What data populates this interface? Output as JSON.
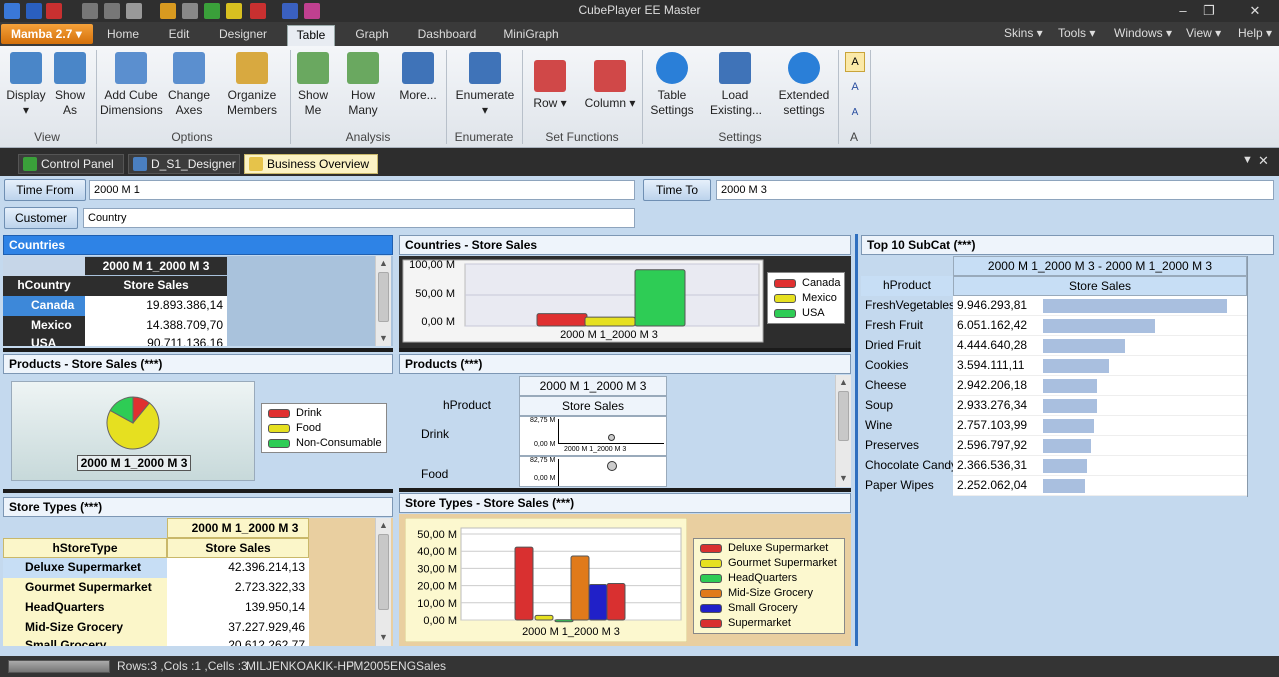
{
  "window": {
    "title": "CubePlayer EE Master"
  },
  "menu": {
    "app_button": "Mamba 2.7",
    "tabs": [
      {
        "label": "Home"
      },
      {
        "label": "Edit"
      },
      {
        "label": "Designer"
      },
      {
        "label": "Table"
      },
      {
        "label": "Graph"
      },
      {
        "label": "Dashboard"
      },
      {
        "label": "MiniGraph"
      }
    ],
    "right": [
      {
        "label": "Skins"
      },
      {
        "label": "Tools"
      },
      {
        "label": "Windows"
      },
      {
        "label": "View"
      },
      {
        "label": "Help"
      }
    ]
  },
  "ribbon": {
    "buttons": [
      {
        "label": "Display",
        "icon": "display-icon"
      },
      {
        "label": "Show As",
        "icon": "show-as-icon"
      },
      {
        "label": "Add Cube Dimensions",
        "icon": "add-cube-icon"
      },
      {
        "label": "Change Axes",
        "icon": "change-axes-icon"
      },
      {
        "label": "Organize Members",
        "icon": "organize-members-icon"
      },
      {
        "label": "Show Me",
        "icon": "show-me-icon"
      },
      {
        "label": "How Many",
        "icon": "how-many-icon"
      },
      {
        "label": "More...",
        "icon": "more-icon"
      },
      {
        "label": "Enumerate",
        "icon": "enumerate-icon"
      },
      {
        "label": "Row",
        "icon": "row-icon"
      },
      {
        "label": "Column",
        "icon": "column-icon"
      },
      {
        "label": "Table Settings",
        "icon": "gear-icon"
      },
      {
        "label": "Load Existing...",
        "icon": "load-existing-icon"
      },
      {
        "label": "Extended settings",
        "icon": "gear-icon"
      }
    ],
    "groups": [
      {
        "label": "View"
      },
      {
        "label": "Options"
      },
      {
        "label": "Analysis"
      },
      {
        "label": "Enumerate"
      },
      {
        "label": "Set Functions"
      },
      {
        "label": "Settings"
      },
      {
        "label": "A"
      }
    ]
  },
  "doc_tabs": [
    {
      "label": "Control Panel"
    },
    {
      "label": "D_S1_Designer"
    },
    {
      "label": "Business Overview"
    }
  ],
  "filters": {
    "time_from_label": "Time From",
    "time_from_value": "2000 M 1",
    "time_to_label": "Time To",
    "time_to_value": "2000 M 3",
    "customer_label": "Customer",
    "customer_value": "Country"
  },
  "countries_grid": {
    "title": "Countries",
    "period": "2000 M 1_2000 M 3",
    "dim_header": "hCountry",
    "measure": "Store Sales",
    "rows": [
      {
        "label": "Canada",
        "value": "19.893.386,14"
      },
      {
        "label": "Mexico",
        "value": "14.388.709,70"
      },
      {
        "label": "USA",
        "value": "90.711.136,16"
      }
    ]
  },
  "countries_chart": {
    "title": "Countries - Store Sales",
    "xlabel": "2000 M 1_2000 M 3",
    "yticks": [
      "100,00 M",
      "50,00 M",
      "0,00 M"
    ],
    "legend": [
      "Canada",
      "Mexico",
      "USA"
    ],
    "colors": [
      "#e03030",
      "#e6e020",
      "#2ecc55"
    ]
  },
  "products_pie": {
    "title": "Products - Store Sales (***)",
    "label": "2000 M 1_2000 M 3",
    "legend": [
      "Drink",
      "Food",
      "Non-Consumable"
    ],
    "colors": [
      "#e03030",
      "#e6e020",
      "#2ecc55"
    ]
  },
  "products_grid": {
    "title": "Products (***)",
    "period": "2000 M 1_2000 M 3",
    "dim_header": "hProduct",
    "measure": "Store Sales",
    "rows": [
      {
        "label": "Drink"
      },
      {
        "label": "Food"
      }
    ],
    "mini_ticks": [
      "82,75 M",
      "0,00 M"
    ],
    "mini_xlabel": "2000 M 1_2000 M 3"
  },
  "store_types_grid": {
    "title": "Store Types (***)",
    "period": "2000 M 1_2000 M 3",
    "dim_header": "hStoreType",
    "measure": "Store Sales",
    "rows": [
      {
        "label": "Deluxe Supermarket",
        "value": "42.396.214,13"
      },
      {
        "label": "Gourmet Supermarket",
        "value": "2.723.322,33"
      },
      {
        "label": "HeadQuarters",
        "value": "139.950,14"
      },
      {
        "label": "Mid-Size Grocery",
        "value": "37.227.929,46"
      },
      {
        "label": "Small Grocery",
        "value": "20.612.262,77"
      }
    ]
  },
  "store_types_chart": {
    "title": "Store Types - Store Sales (***)",
    "xlabel": "2000 M 1_2000 M 3",
    "yticks": [
      "50,00 M",
      "40,00 M",
      "30,00 M",
      "20,00 M",
      "10,00 M",
      "0,00 M"
    ],
    "legend": [
      "Deluxe Supermarket",
      "Gourmet Supermarket",
      "HeadQuarters",
      "Mid-Size Grocery",
      "Small Grocery",
      "Supermarket"
    ],
    "colors": [
      "#d93030",
      "#e6e020",
      "#2ecc55",
      "#e07a1a",
      "#2020c8",
      "#d93030"
    ]
  },
  "top10": {
    "title": "Top 10 SubCat (***)",
    "period": "2000 M 1_2000 M 3 - 2000 M 1_2000 M 3",
    "dim_header": "hProduct",
    "measure": "Store Sales",
    "rows": [
      {
        "label": "FreshVegetables",
        "value": "9.946.293,81",
        "amount": 9946293.81
      },
      {
        "label": "Fresh Fruit",
        "value": "6.051.162,42",
        "amount": 6051162.42
      },
      {
        "label": "Dried Fruit",
        "value": "4.444.640,28",
        "amount": 4444640.28
      },
      {
        "label": "Cookies",
        "value": "3.594.111,11",
        "amount": 3594111.11
      },
      {
        "label": "Cheese",
        "value": "2.942.206,18",
        "amount": 2942206.18
      },
      {
        "label": "Soup",
        "value": "2.933.276,34",
        "amount": 2933276.34
      },
      {
        "label": "Wine",
        "value": "2.757.103,99",
        "amount": 2757103.99
      },
      {
        "label": "Preserves",
        "value": "2.596.797,92",
        "amount": 2596797.92
      },
      {
        "label": "Chocolate Candy",
        "value": "2.366.536,31",
        "amount": 2366536.31
      },
      {
        "label": "Paper Wipes",
        "value": "2.252.062,04",
        "amount": 2252062.04
      }
    ]
  },
  "chart_data": [
    {
      "type": "bar",
      "title": "Countries - Store Sales",
      "categories": [
        "2000 M 1_2000 M 3"
      ],
      "series": [
        {
          "name": "Canada",
          "values": [
            19.89
          ]
        },
        {
          "name": "Mexico",
          "values": [
            14.39
          ]
        },
        {
          "name": "USA",
          "values": [
            90.71
          ]
        }
      ],
      "ylim": [
        0,
        100
      ],
      "ylabel_unit": "M",
      "legend": "right"
    },
    {
      "type": "pie",
      "title": "Products - Store Sales (***)",
      "labels": [
        "Drink",
        "Food",
        "Non-Consumable"
      ],
      "values": [
        11,
        72,
        17
      ],
      "legend": "right"
    },
    {
      "type": "bar",
      "title": "Store Types - Store Sales (***)",
      "categories": [
        "2000 M 1_2000 M 3"
      ],
      "series": [
        {
          "name": "Deluxe Supermarket",
          "values": [
            42.4
          ]
        },
        {
          "name": "Gourmet Supermarket",
          "values": [
            2.72
          ]
        },
        {
          "name": "HeadQuarters",
          "values": [
            0.14
          ]
        },
        {
          "name": "Mid-Size Grocery",
          "values": [
            37.23
          ]
        },
        {
          "name": "Small Grocery",
          "values": [
            20.61
          ]
        },
        {
          "name": "Supermarket",
          "values": [
            21.2
          ]
        }
      ],
      "ylim": [
        0,
        50
      ],
      "legend": "right"
    }
  ],
  "status": {
    "rows_cols_cells": "Rows:3 ,Cols :1 ,Cells :3",
    "machine": "MILJENKOAKIK-HP",
    "db": "FM2005ENG",
    "cube": "Sales"
  }
}
